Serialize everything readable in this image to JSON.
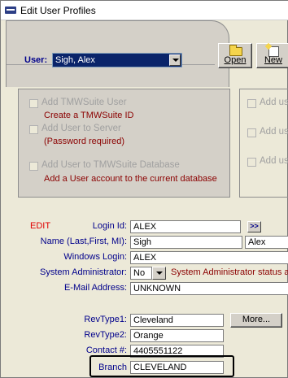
{
  "window": {
    "title": "Edit User Profiles"
  },
  "header": {
    "user_label": "User:",
    "user_value": "Sigh, Alex",
    "open_label": "Open",
    "new_label": "New"
  },
  "options": {
    "add_tmwsuite_user": "Add TMWSuite User",
    "add_tmwsuite_user_sub": "Create a TMWSuite ID",
    "add_to_server": "Add User to Server",
    "add_to_server_sub": "(Password required)",
    "add_to_db": "Add User to TMWSuite Database",
    "add_to_db_sub": "Add a User account to the current database",
    "right_add_1": "Add us",
    "right_add_2": "Add us",
    "right_add_3": "Add us"
  },
  "form": {
    "edit_label": "EDIT",
    "login_id_label": "Login Id:",
    "login_id_value": "ALEX",
    "login_btn": ">>",
    "name_label": "Name (Last,First, MI):",
    "last_name": "Sigh",
    "first_name": "Alex",
    "windows_login_label": "Windows Login:",
    "windows_login_value": "ALEX",
    "sysadmin_label": "System Administrator:",
    "sysadmin_value": "No",
    "sysadmin_msg": "System Administrator status a",
    "email_label": "E-Mail Address:",
    "email_value": "UNKNOWN",
    "revtype1_label": "RevType1:",
    "revtype1_value": "Cleveland",
    "more_btn": "More...",
    "revtype2_label": "RevType2:",
    "revtype2_value": "Orange",
    "contact_label": "Contact #:",
    "contact_value": "4405551122",
    "branch_label": "Branch",
    "branch_value": "CLEVELAND"
  }
}
